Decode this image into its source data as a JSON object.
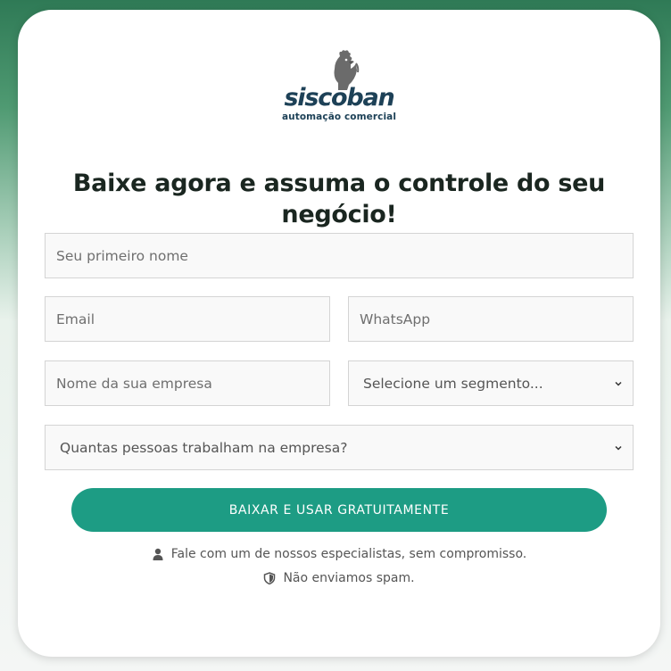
{
  "logo": {
    "wordmark": "siscoban",
    "tagline": "automação comercial"
  },
  "headline": "Baixe agora e assuma o controle do seu negócio!",
  "form": {
    "first_name_placeholder": "Seu primeiro nome",
    "email_placeholder": "Email",
    "whatsapp_placeholder": "WhatsApp",
    "company_placeholder": "Nome da sua empresa",
    "segment_selected": "Selecione um segmento...",
    "employees_selected": "Quantas pessoas trabalham na empresa?",
    "submit_label": "BAIXAR E USAR GRATUITAMENTE"
  },
  "notes": {
    "specialist": "Fale com um de nossos especialistas, sem compromisso.",
    "spam": "Não enviamos spam."
  },
  "colors": {
    "accent": "#1d9c84",
    "brand": "#1d4157",
    "background_top": "#2f7a56"
  },
  "icons": [
    "rooster-logo-icon",
    "chevron-down-icon",
    "user-icon",
    "shield-icon"
  ]
}
